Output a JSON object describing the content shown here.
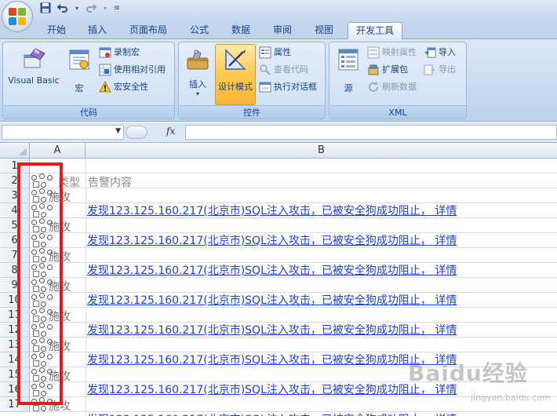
{
  "quick_access": {
    "save_icon": "save-icon",
    "undo_icon": "undo-icon",
    "redo_icon": "redo-icon"
  },
  "tabs": [
    {
      "label": "开始"
    },
    {
      "label": "插入"
    },
    {
      "label": "页面布局"
    },
    {
      "label": "公式"
    },
    {
      "label": "数据"
    },
    {
      "label": "审阅"
    },
    {
      "label": "视图"
    },
    {
      "label": "开发工具",
      "active": true
    }
  ],
  "ribbon": {
    "code_group": {
      "label": "代码",
      "visual_basic": "Visual Basic",
      "macro": "宏",
      "record_macro": "录制宏",
      "relative_ref": "使用相对引用",
      "macro_security": "宏安全性"
    },
    "controls_group": {
      "label": "控件",
      "insert": "插入",
      "design_mode": "设计模式",
      "properties": "属性",
      "view_code": "查看代码",
      "run_dialog": "执行对话框"
    },
    "xml_group": {
      "label": "XML",
      "source": "源",
      "map_properties": "映射属性",
      "expansion_packs": "扩展包",
      "refresh_data": "刷新数据",
      "import": "导入",
      "export": "导出"
    }
  },
  "formula_bar": {
    "fx_label": "fx",
    "name_value": "",
    "formula_value": ""
  },
  "sheet": {
    "columns": [
      {
        "label": "A"
      },
      {
        "label": "B"
      }
    ],
    "rows": [
      "1",
      "2",
      "3",
      "4",
      "5",
      "6",
      "7",
      "8",
      "9",
      "10",
      "11",
      "12",
      "13",
      "14",
      "15",
      "16",
      "17"
    ],
    "header_type": "类型",
    "header_content": "告警内容",
    "type_label": "攻",
    "type_label_prefix": "施",
    "alert_text": "发现123.125.160.217(北京市)SQL注入攻击，已被安全狗成功阻止，  详情"
  },
  "watermark": {
    "text": "Baidu经验",
    "sub": "jingyan.baidu.com"
  }
}
